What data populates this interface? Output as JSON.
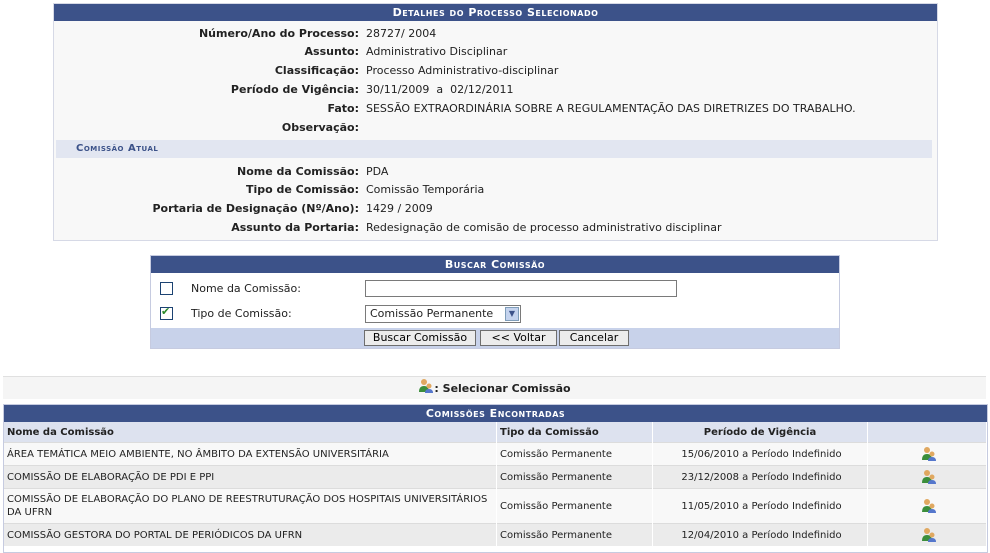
{
  "details": {
    "title": "Detalhes do Processo Selecionado",
    "fields": [
      {
        "label": "Número/Ano do Processo:",
        "value": "28727/ 2004"
      },
      {
        "label": "Assunto:",
        "value": "Administrativo Disciplinar"
      },
      {
        "label": "Classificação:",
        "value": "Processo Administrativo-disciplinar"
      },
      {
        "label": "Período de Vigência:",
        "value": "30/11/2009  a  02/12/2011"
      },
      {
        "label": "Fato:",
        "value": "SESSÃO EXTRAORDINÁRIA SOBRE A REGULAMENTAÇÃO DAS DIRETRIZES DO TRABALHO."
      },
      {
        "label": "Observação:",
        "value": ""
      }
    ],
    "section_title": "Comissão Atual",
    "commission": [
      {
        "label": "Nome da Comissão:",
        "value": "PDA"
      },
      {
        "label": "Tipo de Comissão:",
        "value": "Comissão Temporária"
      },
      {
        "label": "Portaria de Designação (Nº/Ano):",
        "value": "1429 / 2009"
      },
      {
        "label": "Assunto da Portaria:",
        "value": "Redesignação de comisão de processo administrativo disciplinar"
      }
    ]
  },
  "search": {
    "title": "Buscar Comissão",
    "nome_label": "Nome da Comissão:",
    "nome_value": "",
    "nome_checked": false,
    "tipo_label": "Tipo de Comissão:",
    "tipo_value": "Comissão Permanente",
    "tipo_checked": true,
    "buttons": {
      "buscar": "Buscar Comissão",
      "voltar": "<< Voltar",
      "cancelar": "Cancelar"
    }
  },
  "legend": {
    "text": ": Selecionar Comissão",
    "icon": "select-commission-icon"
  },
  "results": {
    "title": "Comissões Encontradas",
    "columns": [
      "Nome da Comissão",
      "Tipo da Comissão",
      "Período de Vigência",
      ""
    ],
    "rows": [
      {
        "nome": "ÁREA TEMÁTICA MEIO AMBIENTE, NO ÂMBITO DA EXTENSÃO UNIVERSITÁRIA",
        "tipo": "Comissão Permanente",
        "periodo": "15/06/2010 a Período Indefinido"
      },
      {
        "nome": "COMISSÃO DE ELABORAÇÃO DE PDI E PPI",
        "tipo": "Comissão Permanente",
        "periodo": "23/12/2008 a Período Indefinido"
      },
      {
        "nome": "COMISSÃO DE ELABORAÇÃO DO PLANO DE REESTRUTURAÇÃO DOS HOSPITAIS UNIVERSITÁRIOS DA UFRN",
        "tipo": "Comissão Permanente",
        "periodo": "11/05/2010 a Período Indefinido"
      },
      {
        "nome": "COMISSÃO GESTORA DO PORTAL DE PERIÓDICOS DA UFRN",
        "tipo": "Comissão Permanente",
        "periodo": "12/04/2010 a Período Indefinido"
      }
    ]
  }
}
